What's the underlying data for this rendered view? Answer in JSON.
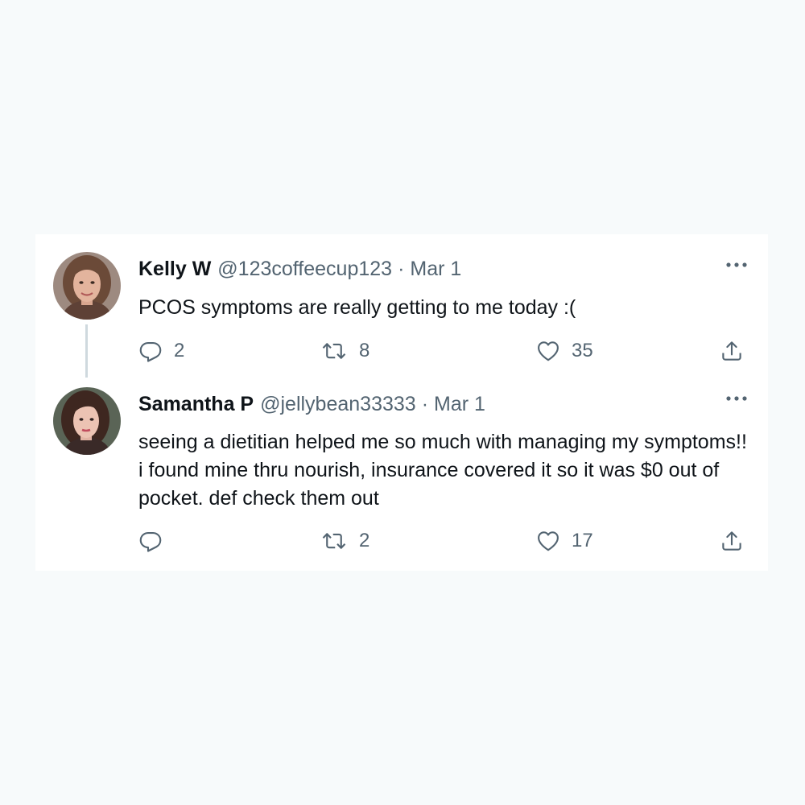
{
  "tweets": [
    {
      "name": "Kelly W",
      "handle": "@123coffeecup123",
      "separator": "·",
      "date": "Mar 1",
      "text": "PCOS symptoms are really getting to me today :(",
      "replies": "2",
      "retweets": "8",
      "likes": "35",
      "avatar_icon": "avatar-woman-brown-hair"
    },
    {
      "name": "Samantha P",
      "handle": "@jellybean33333",
      "separator": "·",
      "date": "Mar 1",
      "text": "seeing a dietitian helped me so much with managing my symptoms!! i found mine thru nourish, insurance covered it so it was $0 out of pocket. def check them out",
      "replies": "",
      "retweets": "2",
      "likes": "17",
      "avatar_icon": "avatar-woman-dark-hair"
    }
  ],
  "icons": {
    "reply": "reply-icon",
    "retweet": "retweet-icon",
    "like": "heart-icon",
    "share": "share-icon",
    "more": "more-icon"
  },
  "colors": {
    "background": "#f7fafb",
    "card": "#ffffff",
    "text": "#0f1419",
    "secondary": "#536471",
    "thread_line": "#cfd9de"
  }
}
